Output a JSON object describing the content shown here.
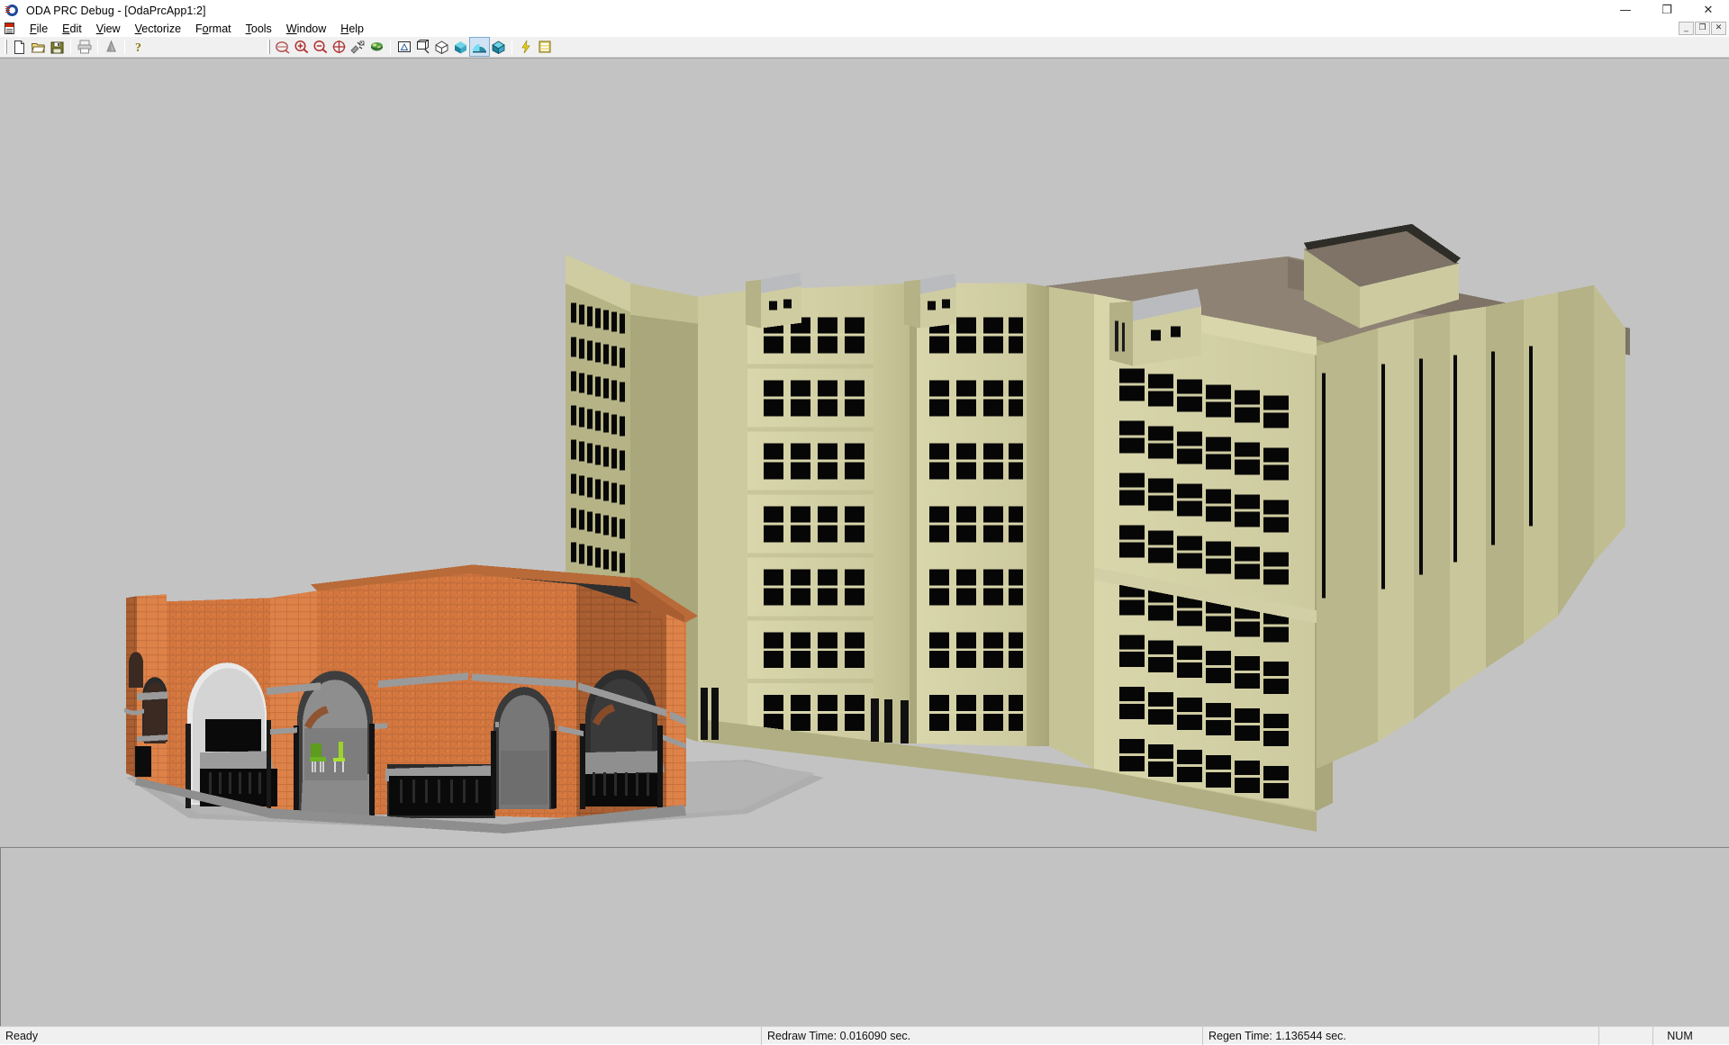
{
  "window": {
    "title": "ODA PRC Debug - [OdaPrcApp1:2]",
    "app_icon": "oda-ring-icon",
    "controls": {
      "minimize": "minimize-icon",
      "maximize": "maximize-icon",
      "close": "close-icon"
    }
  },
  "mdi_controls": {
    "minimize": "_",
    "restore": "❐",
    "close": "✕"
  },
  "menubar": {
    "doc_icon": "document-icon",
    "items": [
      {
        "label": "File",
        "accel": "F"
      },
      {
        "label": "Edit",
        "accel": "E"
      },
      {
        "label": "View",
        "accel": "V"
      },
      {
        "label": "Vectorize",
        "accel": "V"
      },
      {
        "label": "Format",
        "accel": "o"
      },
      {
        "label": "Tools",
        "accel": "T"
      },
      {
        "label": "Window",
        "accel": "W"
      },
      {
        "label": "Help",
        "accel": "H"
      }
    ]
  },
  "toolbar": {
    "file_group": [
      {
        "name": "new-file-icon",
        "tip": "New"
      },
      {
        "name": "open-folder-icon",
        "tip": "Open"
      },
      {
        "name": "save-disk-icon",
        "tip": "Save"
      }
    ],
    "print_group": [
      {
        "name": "print-icon",
        "tip": "Print"
      }
    ],
    "render_group": [
      {
        "name": "cone-render-icon",
        "tip": "Render"
      }
    ],
    "help_group": [
      {
        "name": "help-question-icon",
        "tip": "About"
      }
    ],
    "view_group": [
      {
        "name": "zoom-window-icon",
        "tip": "Zoom Window"
      },
      {
        "name": "zoom-in-icon",
        "tip": "Zoom In"
      },
      {
        "name": "zoom-out-icon",
        "tip": "Zoom Out"
      },
      {
        "name": "zoom-extents-icon",
        "tip": "Zoom Extents"
      },
      {
        "name": "orbit-icon",
        "tip": "3D Orbit"
      },
      {
        "name": "pan-globe-icon",
        "tip": "Pan / Walk"
      }
    ],
    "display_group": [
      {
        "name": "wireframe-2d-icon",
        "tip": "2D Wireframe"
      },
      {
        "name": "wireframe-3d-icon",
        "tip": "3D Wireframe"
      },
      {
        "name": "hidden-line-icon",
        "tip": "Hidden Line"
      },
      {
        "name": "flat-shaded-icon",
        "tip": "Flat Shaded"
      },
      {
        "name": "gouraud-shaded-icon",
        "tip": "Gouraud Shaded"
      },
      {
        "name": "flat-edges-icon",
        "tip": "Flat Shaded with Edges"
      },
      {
        "name": "gouraud-edges-icon",
        "tip": "Gouraud Shaded with Edges"
      }
    ],
    "extra_group": [
      {
        "name": "lightning-bolt-icon",
        "tip": "Regen"
      },
      {
        "name": "properties-icon",
        "tip": "Properties"
      }
    ]
  },
  "statusbar": {
    "ready": "Ready",
    "redraw_time": "Redraw Time: 0.016090 sec.",
    "regen_time": "Regen Time: 1.136544 sec.",
    "num_lock": "NUM"
  },
  "viewport": {
    "background_color": "#c3c3c3",
    "model_name": "architectural-campus-model",
    "objects": [
      {
        "name": "brick-pavilion",
        "description": "Octagonal red-brick arcade pavilion with dark flat roof and arched openings",
        "wall_color": "#d4753f",
        "wall_shadow_color": "#a6542c",
        "roof_color": "#333333",
        "band_color": "#9a9a9a",
        "ground_color": "#a8a8a8",
        "furniture": [
          {
            "name": "green-chair",
            "color": "#66aa22"
          },
          {
            "name": "green-chair",
            "color": "#8fce2a"
          }
        ]
      },
      {
        "name": "main-stone-block",
        "description": "Tall multi-wing khaki institutional building with grid of dark windows",
        "wall_light_color": "#d5d2a4",
        "wall_mid_color": "#c4c192",
        "wall_dark_color": "#a9a87c",
        "roof_color": "#8e8274",
        "window_color": "#060606",
        "floors": 9,
        "penthouses": [
          {
            "name": "rooftop-penthouse",
            "roof_color": "#b9bbbe"
          },
          {
            "name": "rooftop-penthouse",
            "roof_color": "#b9bbbe"
          },
          {
            "name": "rooftop-penthouse",
            "roof_color": "#b9bbbe"
          }
        ]
      },
      {
        "name": "right-stone-wing",
        "description": "Right-hand khaki wing with stepped setbacks and dense window grid",
        "wall_light_color": "#d5d2a4",
        "wall_dark_color": "#b2af84"
      }
    ]
  }
}
